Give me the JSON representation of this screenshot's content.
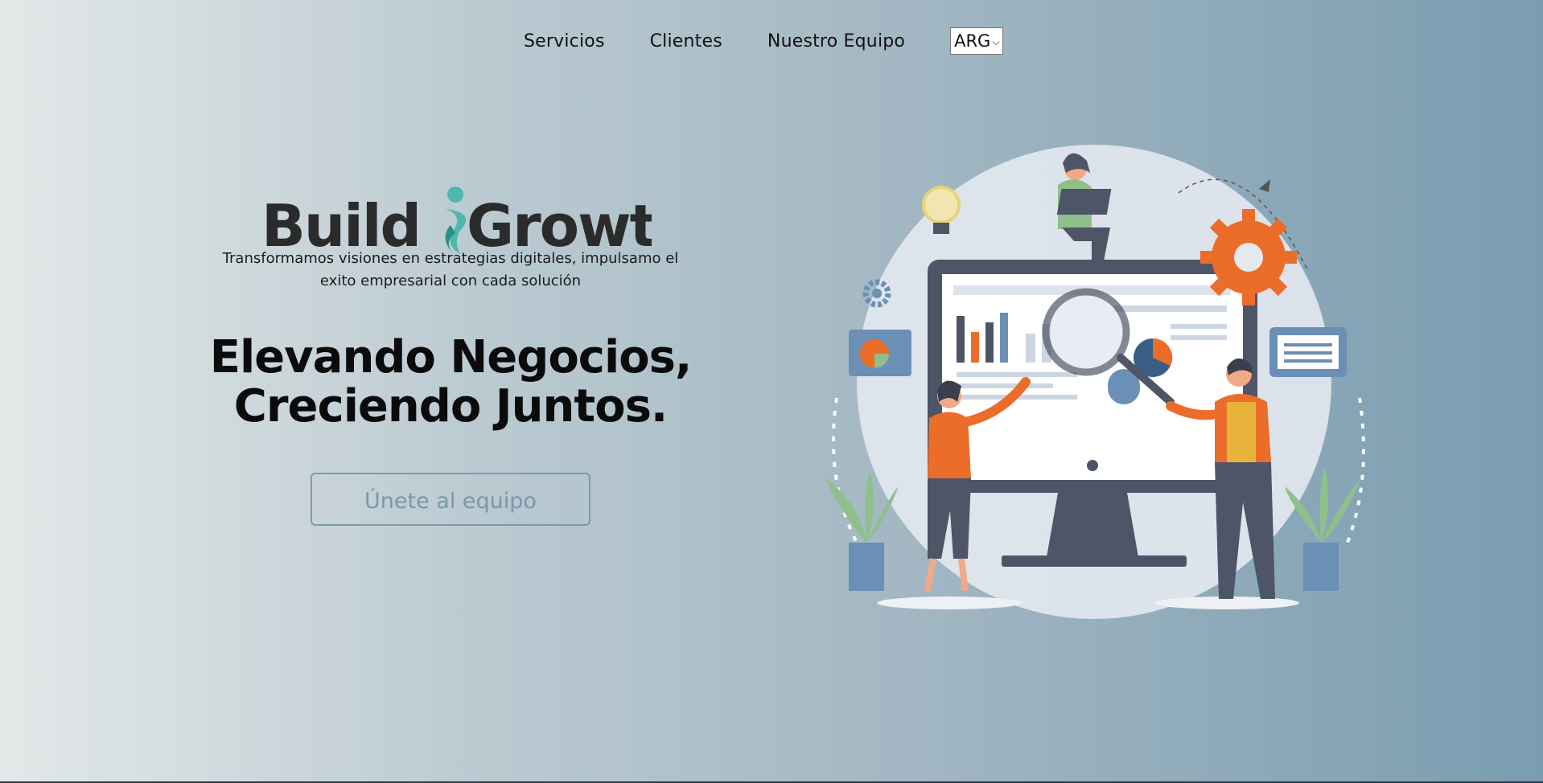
{
  "nav": {
    "links": [
      "Servicios",
      "Clientes",
      "Nuestro Equipo"
    ],
    "language": {
      "selected": "ARG",
      "icon": "chevron-down-icon"
    }
  },
  "hero": {
    "logo_text": {
      "part1": "Build",
      "part2": "Growth"
    },
    "tagline": "Transformamos visiones en estrategias digitales, impulsamo el exito empresarial con cada solución",
    "headline_line1": "Elevando Negocios,",
    "headline_line2": "Creciendo Juntos.",
    "cta_label": "Únete al equipo"
  },
  "colors": {
    "accent_teal": "#4fb8ad",
    "logo_dark": "#2b2b2b",
    "illustration_orange": "#ec6c2a",
    "cta_border": "#7d9aaa"
  }
}
